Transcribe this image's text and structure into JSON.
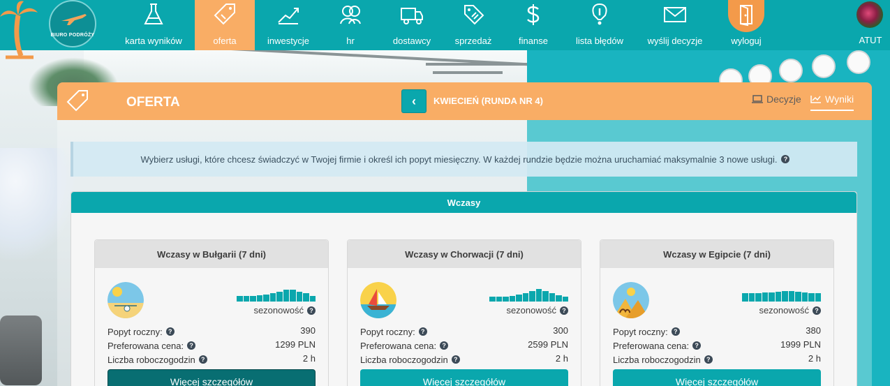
{
  "brand": {
    "logo_text": "BIURO PODRÓŻY"
  },
  "nav": [
    {
      "label": "karta wyników",
      "icon": "flask-icon"
    },
    {
      "label": "oferta",
      "icon": "tag-icon",
      "active": true
    },
    {
      "label": "inwestycje",
      "icon": "growth-chart-icon"
    },
    {
      "label": "hr",
      "icon": "people-icon"
    },
    {
      "label": "dostawcy",
      "icon": "truck-icon"
    },
    {
      "label": "sprzedaż",
      "icon": "price-tag-icon"
    },
    {
      "label": "finanse",
      "icon": "dollar-icon"
    },
    {
      "label": "lista błędów",
      "icon": "exclamation-icon"
    },
    {
      "label": "wyślij decyzje",
      "icon": "envelope-icon"
    },
    {
      "label": "wyloguj",
      "icon": "door-icon"
    }
  ],
  "user": {
    "name": "ATUT"
  },
  "header": {
    "title": "OFERTA",
    "round": "KWIECIEŃ (RUNDA NR 4)",
    "tabs": [
      {
        "label": "Decyzje",
        "icon": "laptop-icon"
      },
      {
        "label": "Wyniki",
        "icon": "line-chart-icon",
        "active": true
      }
    ]
  },
  "info": {
    "text": "Wybierz usługi, które chcesz świadczyć w Twojej firmie i określ ich popyt miesięczny. W każdej rundzie będzie można uruchamiać maksymalnie 3 nowe usługi."
  },
  "section": {
    "title": "Wczasy"
  },
  "labels": {
    "seasonality": "sezonowość",
    "demand": "Popyt roczny:",
    "price": "Preferowana cena:",
    "hours": "Liczba roboczogodzin",
    "more": "Więcej szczegółów"
  },
  "cards": [
    {
      "title": "Wczasy w Bułgarii (7 dni)",
      "icon": "beach-volleyball-icon",
      "demand": "390",
      "price": "1299 PLN",
      "hours": "2 h",
      "season": [
        0.35,
        0.35,
        0.35,
        0.4,
        0.45,
        0.55,
        0.65,
        0.75,
        0.75,
        0.65,
        0.55,
        0.35
      ]
    },
    {
      "title": "Wczasy w Chorwacji (7 dni)",
      "icon": "sailboat-icon",
      "demand": "300",
      "price": "2599 PLN",
      "hours": "2 h",
      "season": [
        0.3,
        0.3,
        0.3,
        0.35,
        0.45,
        0.55,
        0.7,
        0.8,
        0.7,
        0.55,
        0.4,
        0.3
      ]
    },
    {
      "title": "Wczasy w Egipcie (7 dni)",
      "icon": "camel-desert-icon",
      "demand": "380",
      "price": "1999 PLN",
      "hours": "2 h",
      "season": [
        0.55,
        0.55,
        0.55,
        0.6,
        0.6,
        0.65,
        0.7,
        0.7,
        0.65,
        0.6,
        0.55,
        0.55
      ]
    }
  ],
  "colors": {
    "teal": "#0aa7ad",
    "orange": "#f9ad65",
    "dark_teal": "#086e72"
  }
}
